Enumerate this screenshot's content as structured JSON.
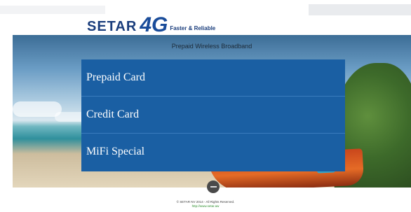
{
  "header": {
    "brand": "SETAR",
    "brand_accent": "4G",
    "tagline": "Faster & Reliable"
  },
  "hero": {
    "title": "Prepaid Wireless Broadband"
  },
  "menu": {
    "items": [
      {
        "label": "Prepaid Card"
      },
      {
        "label": "Credit Card"
      },
      {
        "label": "MiFi Special"
      }
    ]
  },
  "footer": {
    "copyright": "© SETAR NV 2014 - All Rights Reserved.",
    "link": "http://www.setar.aw"
  },
  "colors": {
    "menu_bg": "#1a5fa3",
    "brand_blue": "#1a3d7c",
    "link_green": "#2f8f2f"
  },
  "icons": {
    "collapse": "minus-circle-icon"
  }
}
